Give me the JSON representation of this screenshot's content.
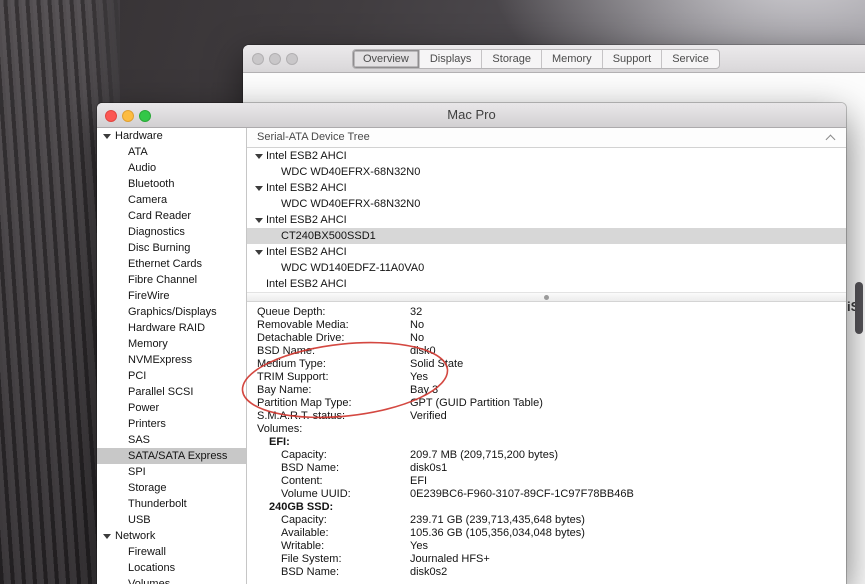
{
  "background_window": {
    "tabs": [
      {
        "label": "Overview",
        "selected": true
      },
      {
        "label": "Displays",
        "selected": false
      },
      {
        "label": "Storage",
        "selected": false
      },
      {
        "label": "Memory",
        "selected": false
      },
      {
        "label": "Support",
        "selected": false
      },
      {
        "label": "Service",
        "selected": false
      }
    ],
    "edge_text": "iS"
  },
  "window": {
    "title": "Mac Pro",
    "sidebar": {
      "selected_item": "SATA/SATA Express",
      "sections": [
        {
          "label": "Hardware",
          "items": [
            "ATA",
            "Audio",
            "Bluetooth",
            "Camera",
            "Card Reader",
            "Diagnostics",
            "Disc Burning",
            "Ethernet Cards",
            "Fibre Channel",
            "FireWire",
            "Graphics/Displays",
            "Hardware RAID",
            "Memory",
            "NVMExpress",
            "PCI",
            "Parallel SCSI",
            "Power",
            "Printers",
            "SAS",
            "SATA/SATA Express",
            "SPI",
            "Storage",
            "Thunderbolt",
            "USB"
          ]
        },
        {
          "label": "Network",
          "items": [
            "Firewall",
            "Locations",
            "Volumes"
          ]
        }
      ]
    },
    "device_tree": {
      "header": "Serial-ATA Device Tree",
      "rows": [
        {
          "label": "Intel ESB2 AHCI",
          "level": 0,
          "disclosure": true,
          "selected": false
        },
        {
          "label": "WDC WD40EFRX-68N32N0",
          "level": 1,
          "disclosure": false,
          "selected": false
        },
        {
          "label": "Intel ESB2 AHCI",
          "level": 0,
          "disclosure": true,
          "selected": false
        },
        {
          "label": "WDC WD40EFRX-68N32N0",
          "level": 1,
          "disclosure": false,
          "selected": false
        },
        {
          "label": "Intel ESB2 AHCI",
          "level": 0,
          "disclosure": true,
          "selected": false
        },
        {
          "label": "CT240BX500SSD1",
          "level": 1,
          "disclosure": false,
          "selected": true
        },
        {
          "label": "Intel ESB2 AHCI",
          "level": 0,
          "disclosure": true,
          "selected": false
        },
        {
          "label": "WDC WD140EDFZ-11A0VA0",
          "level": 1,
          "disclosure": false,
          "selected": false
        },
        {
          "label": "Intel ESB2 AHCI",
          "level": 0,
          "disclosure": false,
          "selected": false
        }
      ]
    },
    "details": {
      "rows": [
        {
          "label": "Queue Depth:",
          "value": "32",
          "indent": 0,
          "bold": false
        },
        {
          "label": "Removable Media:",
          "value": "No",
          "indent": 0,
          "bold": false
        },
        {
          "label": "Detachable Drive:",
          "value": "No",
          "indent": 0,
          "bold": false
        },
        {
          "label": "BSD Name:",
          "value": "disk0",
          "indent": 0,
          "bold": false
        },
        {
          "label": "Medium Type:",
          "value": "Solid State",
          "indent": 0,
          "bold": false
        },
        {
          "label": "TRIM Support:",
          "value": "Yes",
          "indent": 0,
          "bold": false
        },
        {
          "label": "Bay Name:",
          "value": "Bay 3",
          "indent": 0,
          "bold": false
        },
        {
          "label": "Partition Map Type:",
          "value": "GPT (GUID Partition Table)",
          "indent": 0,
          "bold": false
        },
        {
          "label": "S.M.A.R.T. status:",
          "value": "Verified",
          "indent": 0,
          "bold": false
        },
        {
          "label": "Volumes:",
          "value": "",
          "indent": 0,
          "bold": false
        },
        {
          "label": "EFI:",
          "value": "",
          "indent": 1,
          "bold": true
        },
        {
          "label": "Capacity:",
          "value": "209.7 MB (209,715,200 bytes)",
          "indent": 2,
          "bold": false
        },
        {
          "label": "BSD Name:",
          "value": "disk0s1",
          "indent": 2,
          "bold": false
        },
        {
          "label": "Content:",
          "value": "EFI",
          "indent": 2,
          "bold": false
        },
        {
          "label": "Volume UUID:",
          "value": "0E239BC6-F960-3107-89CF-1C97F78BB46B",
          "indent": 2,
          "bold": false
        },
        {
          "label": "240GB SSD:",
          "value": "",
          "indent": 1,
          "bold": true
        },
        {
          "label": "Capacity:",
          "value": "239.71 GB (239,713,435,648 bytes)",
          "indent": 2,
          "bold": false
        },
        {
          "label": "Available:",
          "value": "105.36 GB (105,356,034,048 bytes)",
          "indent": 2,
          "bold": false
        },
        {
          "label": "Writable:",
          "value": "Yes",
          "indent": 2,
          "bold": false
        },
        {
          "label": "File System:",
          "value": "Journaled HFS+",
          "indent": 2,
          "bold": false
        },
        {
          "label": "BSD Name:",
          "value": "disk0s2",
          "indent": 2,
          "bold": false
        }
      ]
    }
  },
  "annotation": {
    "color": "#cf342c"
  }
}
